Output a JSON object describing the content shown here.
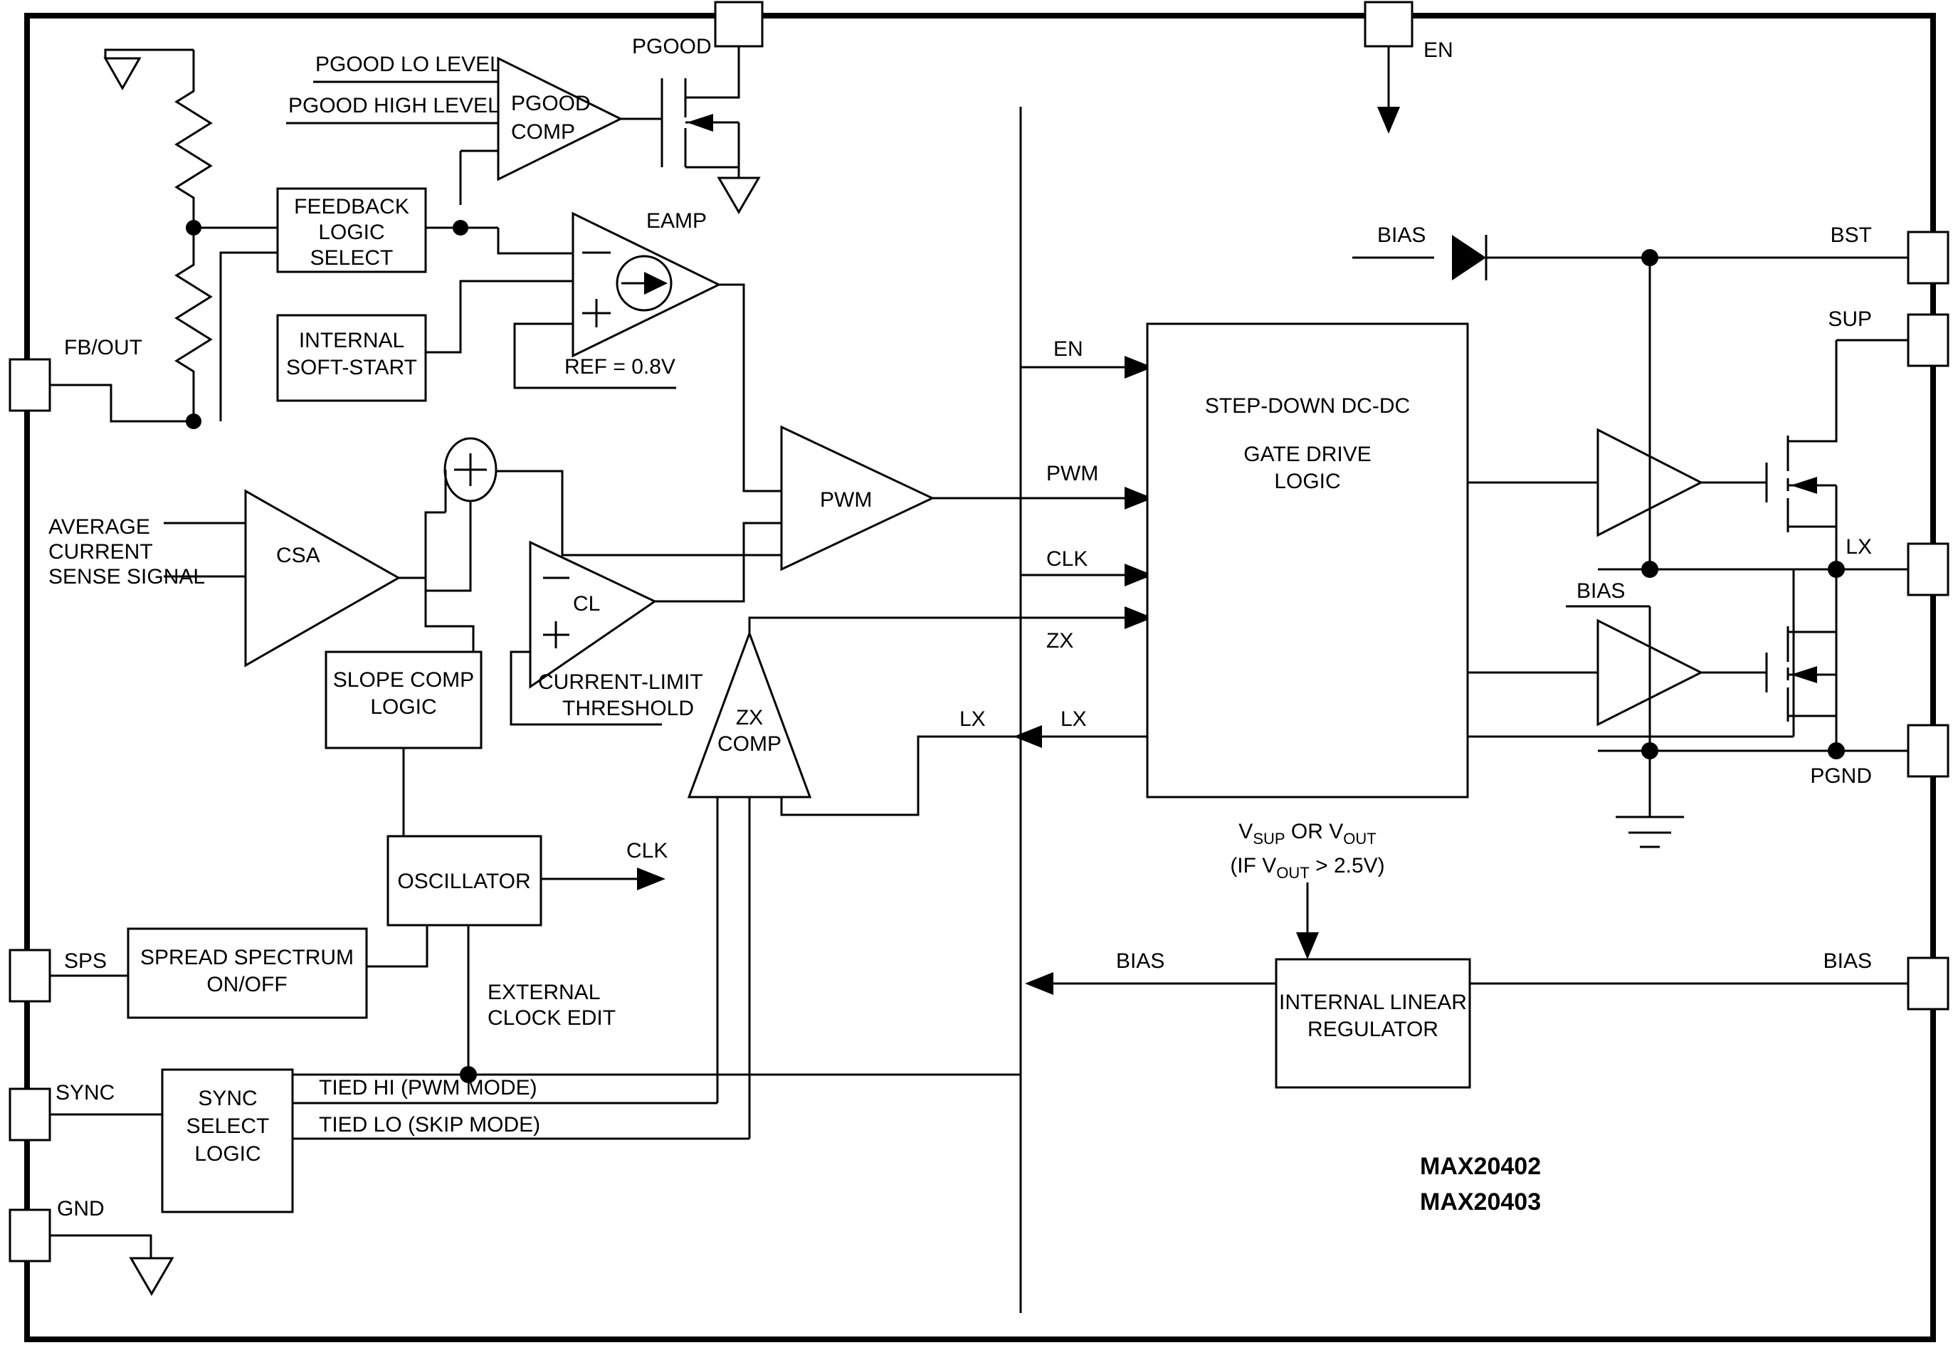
{
  "diagram": {
    "title": "MAX20402 / MAX20403 Step-Down DC-DC Functional Block Diagram",
    "part_numbers": [
      "MAX20402",
      "MAX20403"
    ]
  },
  "pins": {
    "pgood": "PGOOD",
    "en": "EN",
    "fb_out": "FB/OUT",
    "sps": "SPS",
    "sync": "SYNC",
    "gnd": "GND",
    "bst": "BST",
    "sup": "SUP",
    "lx": "LX",
    "pgnd": "PGND",
    "bias": "BIAS"
  },
  "blocks": {
    "feedback_logic_select": [
      "FEEDBACK",
      "LOGIC",
      "SELECT"
    ],
    "internal_soft_start": [
      "INTERNAL",
      "SOFT-START"
    ],
    "slope_comp_logic": [
      "SLOPE COMP",
      "LOGIC"
    ],
    "oscillator": [
      "OSCILLATOR"
    ],
    "spread_spectrum": [
      "SPREAD SPECTRUM",
      "ON/OFF"
    ],
    "sync_select_logic": [
      "SYNC",
      "SELECT",
      "LOGIC"
    ],
    "gate_drive_logic": [
      "STEP-DOWN DC-DC",
      "GATE DRIVE",
      "LOGIC"
    ],
    "internal_linear_regulator": [
      "INTERNAL LINEAR",
      "REGULATOR"
    ]
  },
  "amps": {
    "pgood_comp": [
      "PGOOD",
      "COMP"
    ],
    "eamp": "EAMP",
    "csa": "CSA",
    "cl": "CL",
    "pwm": "PWM",
    "zx_comp": [
      "ZX",
      "COMP"
    ]
  },
  "labels": {
    "pgood_lo_level": "PGOOD LO LEVEL",
    "pgood_high_level": "PGOOD HIGH LEVEL",
    "ref": "REF = 0.8V",
    "avg_current_sense": [
      "AVERAGE",
      "CURRENT",
      "SENSE SIGNAL"
    ],
    "current_limit_threshold": [
      "CURRENT-LIMIT",
      "THRESHOLD"
    ],
    "external_clock_edit": [
      "EXTERNAL",
      "CLOCK EDIT"
    ],
    "tied_hi": "TIED HI (PWM MODE)",
    "tied_lo": "TIED LO (SKIP MODE)",
    "clk_out": "CLK",
    "vsup_or_vout_line1_a": "V",
    "vsup_or_vout_line1_b": "SUP",
    "vsup_or_vout_line1_c": " OR V",
    "vsup_or_vout_line1_d": "OUT",
    "vsup_cond_a": "(IF V",
    "vsup_cond_b": "OUT",
    "vsup_cond_c": " > 2.5V)",
    "bias_diode": "BIAS",
    "bias_lowside": "BIAS",
    "bias_out_left": "BIAS",
    "bias_pin_right": "BIAS"
  },
  "signals": {
    "en": "EN",
    "pwm": "PWM",
    "clk": "CLK",
    "zx": "ZX",
    "lx_left": "LX",
    "lx_right": "LX"
  },
  "symbols": {
    "ground_triangle": "ground-triangle-icon",
    "ground_earth": "earth-ground-icon",
    "resistor": "resistor-icon",
    "diode": "diode-icon",
    "mosfet": "mosfet-icon",
    "summing_node": "summing-node-icon",
    "arrow": "arrow-icon"
  },
  "colors": {
    "line": "#000000",
    "background": "#ffffff",
    "text": "#000000"
  }
}
